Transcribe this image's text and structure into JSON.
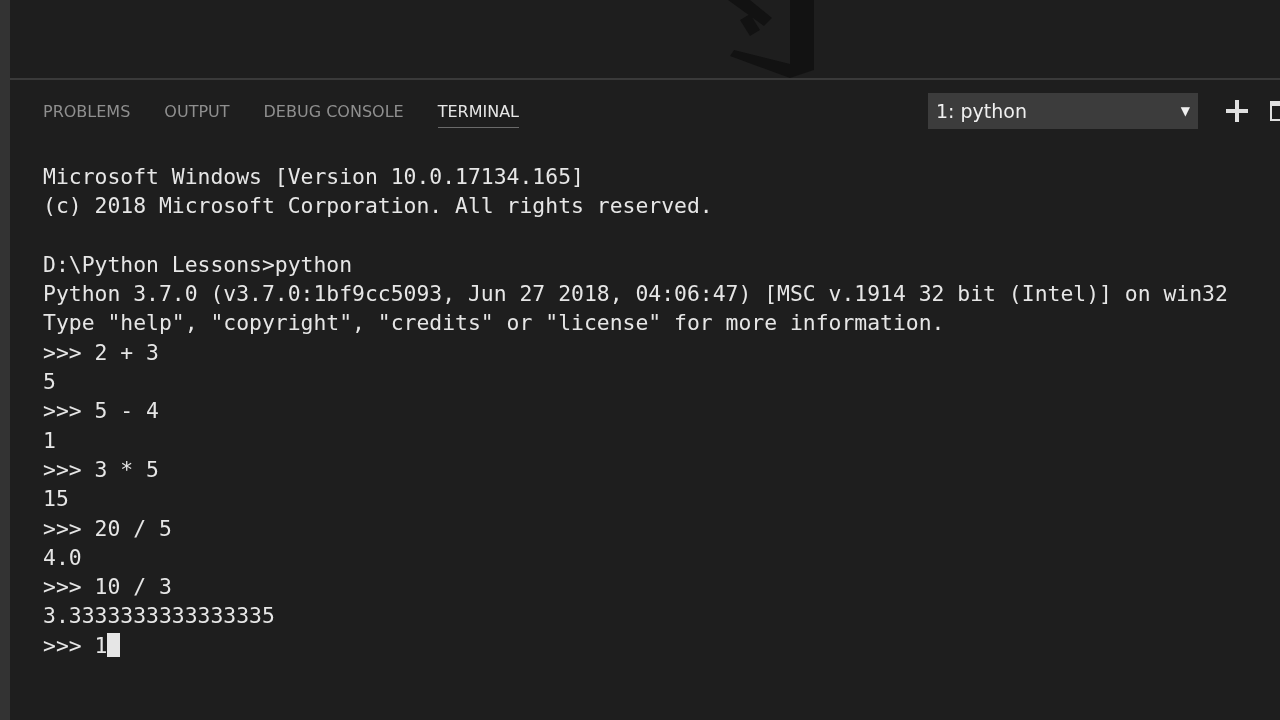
{
  "panel": {
    "tabs": [
      {
        "label": "PROBLEMS",
        "selected": false
      },
      {
        "label": "OUTPUT",
        "selected": false
      },
      {
        "label": "DEBUG CONSOLE",
        "selected": false
      },
      {
        "label": "TERMINAL",
        "selected": true
      }
    ],
    "terminal_select": {
      "value": "1: python",
      "caret": "▼"
    }
  },
  "terminal": {
    "lines": [
      {
        "kind": "text",
        "text": "Microsoft Windows [Version 10.0.17134.165]"
      },
      {
        "kind": "text",
        "text": "(c) 2018 Microsoft Corporation. All rights reserved."
      },
      {
        "kind": "blank"
      },
      {
        "kind": "text",
        "text": "D:\\Python Lessons>python"
      },
      {
        "kind": "text",
        "text": "Python 3.7.0 (v3.7.0:1bf9cc5093, Jun 27 2018, 04:06:47) [MSC v.1914 32 bit (Intel)] on win32"
      },
      {
        "kind": "text",
        "text": "Type \"help\", \"copyright\", \"credits\" or \"license\" for more information."
      },
      {
        "kind": "text",
        "text": ">>> 2 + 3"
      },
      {
        "kind": "text",
        "text": "5"
      },
      {
        "kind": "text",
        "text": ">>> 5 - 4"
      },
      {
        "kind": "text",
        "text": "1"
      },
      {
        "kind": "text",
        "text": ">>> 3 * 5"
      },
      {
        "kind": "text",
        "text": "15"
      },
      {
        "kind": "text",
        "text": ">>> 20 / 5"
      },
      {
        "kind": "text",
        "text": "4.0"
      },
      {
        "kind": "text",
        "text": ">>> 10 / 3"
      },
      {
        "kind": "text",
        "text": "3.3333333333333335"
      },
      {
        "kind": "text",
        "text": ">>> 1",
        "cursor": true
      }
    ]
  }
}
